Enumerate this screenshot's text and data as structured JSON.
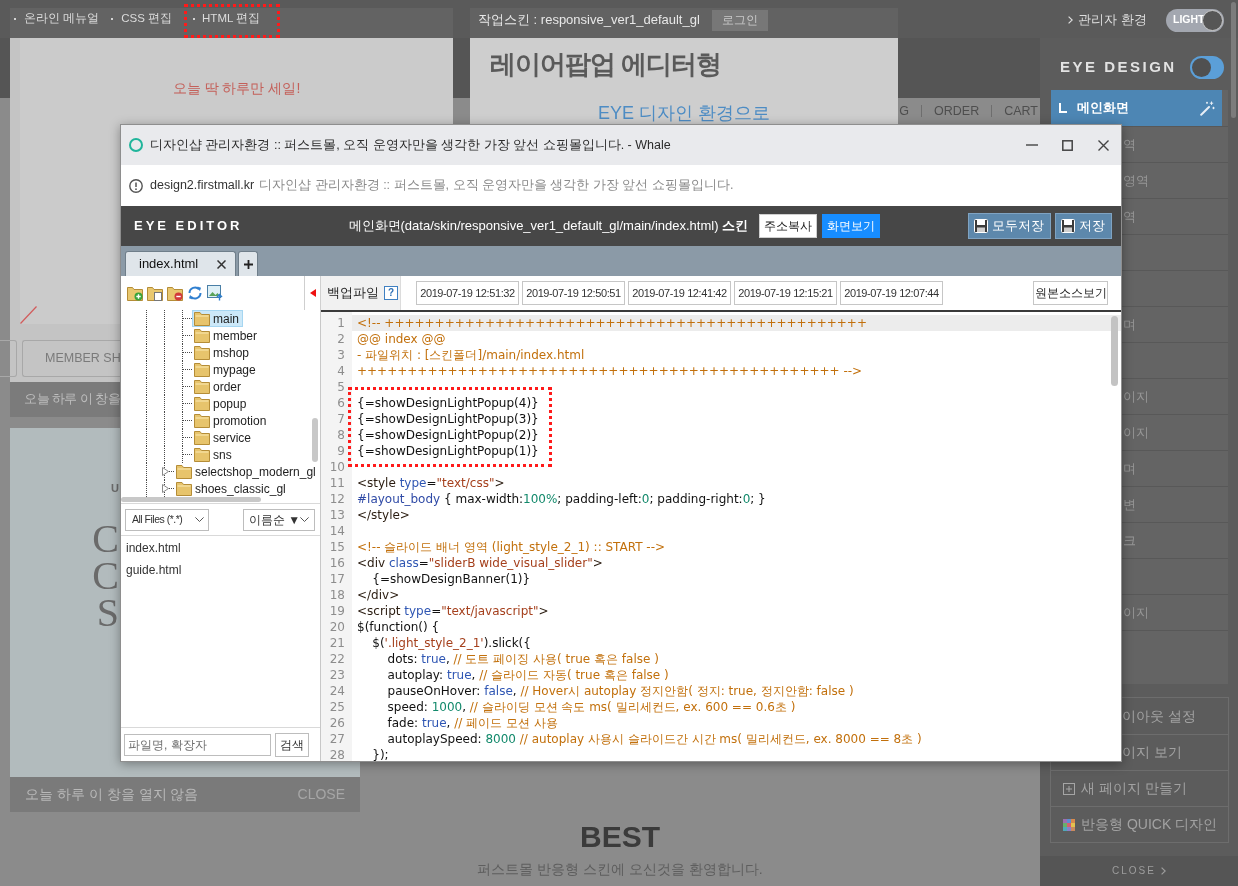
{
  "top_bar": {
    "menu": [
      {
        "label": "온라인 메뉴얼",
        "highlighted": false
      },
      {
        "label": "CSS 편집",
        "highlighted": false
      },
      {
        "label": "HTML 편집",
        "highlighted": true
      }
    ],
    "skin": "작업스킨 : responsive_ver1_default_gl",
    "login": "로그인",
    "admin_link": "관리자 환경",
    "theme_toggle": {
      "label": "LIGHT",
      "on": true
    }
  },
  "background": {
    "sale_popup": {
      "headline": "오늘 딱 하루만 세일!",
      "button": "MEMBER SH",
      "footer": "오늘 하루 이 창을"
    },
    "editor_popup": {
      "title": "레이어팝업 에디터형",
      "subtitle": "EYE 디자인 환경으로"
    },
    "promo_popup": {
      "small_text": "U",
      "large_letters": [
        "C",
        "C",
        "S"
      ],
      "footer": "오늘 하루 이 창을 열지 않음",
      "close": "CLOSE"
    },
    "nav": [
      "G",
      "ORDER",
      "CART"
    ],
    "section": {
      "title": "BEST",
      "subtitle": "퍼스트몰 반응형 스킨에 오신것을 환영합니다."
    }
  },
  "design_panel": {
    "title": "EYE DESIGN",
    "toggle": {
      "on": false
    },
    "items": [
      {
        "label": "메인화면",
        "selected": true
      },
      {
        "label": "역",
        "selected": false
      },
      {
        "label": "영역",
        "selected": false
      },
      {
        "label": "역",
        "selected": false
      },
      {
        "selected": false
      },
      {
        "selected": false
      },
      {
        "label": "며",
        "selected": false
      },
      {
        "selected": false
      },
      {
        "label": "이지",
        "selected": false
      },
      {
        "label": "이지",
        "selected": false
      },
      {
        "label": "며",
        "selected": false
      },
      {
        "label": "변",
        "selected": false
      },
      {
        "label": "크",
        "selected": false
      },
      {
        "selected": false
      },
      {
        "label": "이지",
        "selected": false
      },
      {
        "selected": false
      }
    ],
    "actions": [
      {
        "kind": "text",
        "label": "이아웃 설정"
      },
      {
        "kind": "text",
        "label": "이지 보기"
      },
      {
        "kind": "add",
        "label": "새 페이지 만들기"
      },
      {
        "kind": "quick",
        "label": "반응형 QUICK 디자인"
      }
    ],
    "close": "CLOSE"
  },
  "window": {
    "title": "디자인샵 관리자환경 :: 퍼스트몰, 오직 운영자만을 생각한 가장 앞선 쇼핑몰입니다. - Whale",
    "address": {
      "host": "design2.firstmall.kr",
      "page_title": "디자인샵 관리자환경 :: 퍼스트몰, 오직 운영자만을 생각한 가장 앞선 쇼핑몰입니다."
    },
    "editor": {
      "brand": "EYE EDITOR",
      "path": "메인화면(data/skin/responsive_ver1_default_gl/main/index.html) **스킨**",
      "copy_button": "주소복사",
      "view_button": "화면보기",
      "save_all_button": "모두저장",
      "save_button": "저장",
      "tabs": [
        {
          "label": "index.html",
          "selected": true
        }
      ],
      "backup": {
        "label": "백업파일",
        "help": "?",
        "dates": [
          "2019-07-19 12:51:32",
          "2019-07-19 12:50:51",
          "2019-07-19 12:41:42",
          "2019-07-19 12:15:21",
          "2019-07-19 12:07:44"
        ],
        "source_button": "원본소스보기"
      },
      "tree": [
        {
          "children": [
            {
              "children": [
                {
                  "label": "main",
                  "selected": true
                },
                {
                  "label": "member",
                  "selected": false
                },
                {
                  "label": "mshop",
                  "selected": false
                },
                {
                  "label": "mypage",
                  "selected": false
                },
                {
                  "label": "order",
                  "selected": false
                },
                {
                  "label": "popup",
                  "selected": false
                },
                {
                  "label": "promotion",
                  "selected": false
                },
                {
                  "label": "service",
                  "selected": false
                },
                {
                  "label": "sns",
                  "selected": false
                }
              ]
            },
            {
              "label": "selectshop_modern_gl",
              "selected": false,
              "expanded": false
            },
            {
              "label": "shoes_classic_gl",
              "selected": false,
              "expanded": false
            }
          ]
        }
      ],
      "filter": {
        "type": "All Files (*.*)",
        "sort": "이름순 ▼"
      },
      "files": [
        {
          "name": "index.html"
        },
        {
          "name": "guide.html"
        }
      ],
      "search": {
        "placeholder": "파일명, 확장자",
        "button": "검색"
      },
      "code": {
        "lines": [
          {
            "number": "1",
            "current": true,
            "marked": false,
            "tokens": [
              {
                "text": "<!-- ++++++++++++++++++++++++++++++++++++++++++++++++",
                "kind": "comment"
              }
            ]
          },
          {
            "number": "2",
            "current": false,
            "marked": false,
            "tokens": [
              {
                "text": "@@ index @@",
                "kind": "comment"
              }
            ]
          },
          {
            "number": "3",
            "current": false,
            "marked": false,
            "tokens": [
              {
                "text": "- 파일위치 : [스킨폴더]/main/index.html",
                "kind": "comment"
              }
            ]
          },
          {
            "number": "4",
            "current": false,
            "marked": false,
            "tokens": [
              {
                "text": "++++++++++++++++++++++++++++++++++++++++++++++++ -->",
                "kind": "comment"
              }
            ]
          },
          {
            "number": "5",
            "current": false,
            "marked": false
          },
          {
            "number": "6",
            "current": false,
            "marked": true,
            "tokens": [
              {
                "text": "{=showDesignLightPopup(4)}",
                "kind": "plain"
              }
            ]
          },
          {
            "number": "7",
            "current": false,
            "marked": true,
            "tokens": [
              {
                "text": "{=showDesignLightPopup(3)}",
                "kind": "plain"
              }
            ]
          },
          {
            "number": "8",
            "current": false,
            "marked": true,
            "tokens": [
              {
                "text": "{=showDesignLightPopup(2)}",
                "kind": "plain"
              }
            ]
          },
          {
            "number": "9",
            "current": false,
            "marked": true,
            "tokens": [
              {
                "text": "{=showDesignLightPopup(1)}",
                "kind": "plain"
              }
            ]
          },
          {
            "number": "10",
            "current": false,
            "marked": false
          },
          {
            "number": "11",
            "current": false,
            "marked": false,
            "tokens": [
              {
                "text": "<style ",
                "kind": "tag"
              },
              {
                "text": "type",
                "kind": "attr"
              },
              {
                "text": "=",
                "kind": "plain"
              },
              {
                "text": "\"text/css\"",
                "kind": "string"
              },
              {
                "text": ">",
                "kind": "tag"
              }
            ]
          },
          {
            "number": "12",
            "current": false,
            "marked": false,
            "tokens": [
              {
                "text": "#layout_body",
                "kind": "selector"
              },
              {
                "text": " { max-width:",
                "kind": "plain"
              },
              {
                "text": "100%",
                "kind": "number"
              },
              {
                "text": "; padding-left:",
                "kind": "plain"
              },
              {
                "text": "0",
                "kind": "number"
              },
              {
                "text": "; padding-right:",
                "kind": "plain"
              },
              {
                "text": "0",
                "kind": "number"
              },
              {
                "text": "; }",
                "kind": "plain"
              }
            ]
          },
          {
            "number": "13",
            "current": false,
            "marked": false,
            "tokens": [
              {
                "text": "</style>",
                "kind": "tag"
              }
            ]
          },
          {
            "number": "14",
            "current": false,
            "marked": false
          },
          {
            "number": "15",
            "current": false,
            "marked": false,
            "tokens": [
              {
                "text": "<!-- 슬라이드 배너 영역 (light_style_2_1) :: START -->",
                "kind": "comment"
              }
            ]
          },
          {
            "number": "16",
            "current": false,
            "marked": false,
            "tokens": [
              {
                "text": "<div ",
                "kind": "tag"
              },
              {
                "text": "class",
                "kind": "attr"
              },
              {
                "text": "=",
                "kind": "plain"
              },
              {
                "text": "\"sliderB wide_visual_slider\"",
                "kind": "string"
              },
              {
                "text": ">",
                "kind": "tag"
              }
            ]
          },
          {
            "number": "17",
            "current": false,
            "marked": false,
            "tokens": [
              {
                "text": "    {=showDesignBanner(1)}",
                "kind": "plain"
              }
            ]
          },
          {
            "number": "18",
            "current": false,
            "marked": false,
            "tokens": [
              {
                "text": "</div>",
                "kind": "tag"
              }
            ]
          },
          {
            "number": "19",
            "current": false,
            "marked": false,
            "tokens": [
              {
                "text": "<script ",
                "kind": "tag"
              },
              {
                "text": "type",
                "kind": "attr"
              },
              {
                "text": "=",
                "kind": "plain"
              },
              {
                "text": "\"text/javascript\"",
                "kind": "string"
              },
              {
                "text": ">",
                "kind": "tag"
              }
            ]
          },
          {
            "number": "20",
            "current": false,
            "marked": false,
            "tokens": [
              {
                "text": "$(function() {",
                "kind": "plain"
              }
            ]
          },
          {
            "number": "21",
            "current": false,
            "marked": false,
            "tokens": [
              {
                "text": "    $(",
                "kind": "plain"
              },
              {
                "text": "'.light_style_2_1'",
                "kind": "string"
              },
              {
                "text": ").slick({",
                "kind": "plain"
              }
            ]
          },
          {
            "number": "22",
            "current": false,
            "marked": false,
            "tokens": [
              {
                "text": "        dots: ",
                "kind": "plain"
              },
              {
                "text": "true",
                "kind": "keyword"
              },
              {
                "text": ", ",
                "kind": "plain"
              },
              {
                "text": "// 도트 페이징 사용( true 혹은 false )",
                "kind": "comment"
              }
            ]
          },
          {
            "number": "23",
            "current": false,
            "marked": false,
            "tokens": [
              {
                "text": "        autoplay: ",
                "kind": "plain"
              },
              {
                "text": "true",
                "kind": "keyword"
              },
              {
                "text": ", ",
                "kind": "plain"
              },
              {
                "text": "// 슬라이드 자동( true 혹은 false )",
                "kind": "comment"
              }
            ]
          },
          {
            "number": "24",
            "current": false,
            "marked": false,
            "tokens": [
              {
                "text": "        pauseOnHover: ",
                "kind": "plain"
              },
              {
                "text": "false",
                "kind": "keyword"
              },
              {
                "text": ", ",
                "kind": "plain"
              },
              {
                "text": "// Hover시 autoplay 정지안함( 정지: true, 정지안함: false )",
                "kind": "comment"
              }
            ]
          },
          {
            "number": "25",
            "current": false,
            "marked": false,
            "tokens": [
              {
                "text": "        speed: ",
                "kind": "plain"
              },
              {
                "text": "1000",
                "kind": "number"
              },
              {
                "text": ", ",
                "kind": "plain"
              },
              {
                "text": "// 슬라이딩 모션 속도 ms( 밀리세컨드, ex. 600 == 0.6초 )",
                "kind": "comment"
              }
            ]
          },
          {
            "number": "26",
            "current": false,
            "marked": false,
            "tokens": [
              {
                "text": "        fade: ",
                "kind": "plain"
              },
              {
                "text": "true",
                "kind": "keyword"
              },
              {
                "text": ", ",
                "kind": "plain"
              },
              {
                "text": "// 페이드 모션 사용",
                "kind": "comment"
              }
            ]
          },
          {
            "number": "27",
            "current": false,
            "marked": false,
            "tokens": [
              {
                "text": "        autoplaySpeed: ",
                "kind": "plain"
              },
              {
                "text": "8000",
                "kind": "number"
              },
              {
                "text": " // autoplay 사용시 슬라이드간 시간 ms( 밀리세컨드, ex. 8000 == 8초 )",
                "kind": "comment"
              }
            ]
          },
          {
            "number": "28",
            "current": false,
            "marked": false,
            "tokens": [
              {
                "text": "    });",
                "kind": "plain"
              }
            ]
          }
        ]
      }
    }
  }
}
